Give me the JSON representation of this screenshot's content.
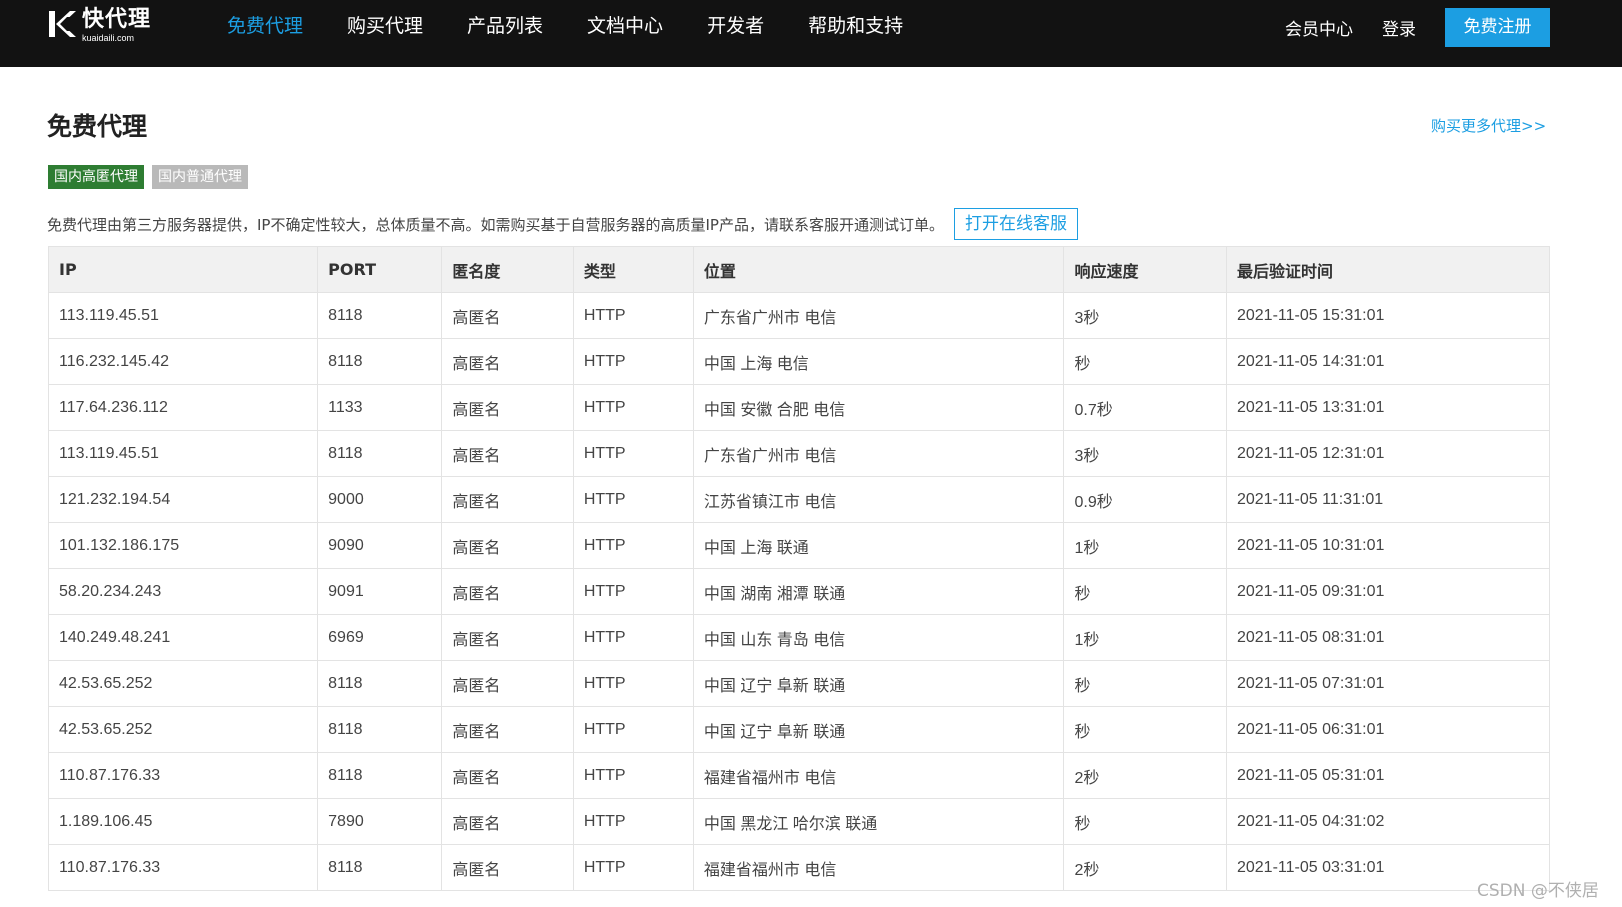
{
  "logo": {
    "cn": "快代理",
    "en": "kuaidaili.com"
  },
  "nav": [
    {
      "label": "免费代理",
      "active": true
    },
    {
      "label": "购买代理",
      "active": false
    },
    {
      "label": "产品列表",
      "active": false
    },
    {
      "label": "文档中心",
      "active": false
    },
    {
      "label": "开发者",
      "active": false
    },
    {
      "label": "帮助和支持",
      "active": false
    }
  ],
  "header_right": {
    "member": "会员中心",
    "login": "登录",
    "register": "免费注册"
  },
  "page": {
    "title": "免费代理",
    "more_link": "购买更多代理>>",
    "tabs": [
      {
        "label": "国内高匿代理",
        "active": true
      },
      {
        "label": "国内普通代理",
        "active": false
      }
    ],
    "notice": "免费代理由第三方服务器提供，IP不确定性较大，总体质量不高。如需购买基于自营服务器的高质量IP产品，请联系客服开通测试订单。",
    "service_button": "打开在线客服"
  },
  "table": {
    "columns": [
      "IP",
      "PORT",
      "匿名度",
      "类型",
      "位置",
      "响应速度",
      "最后验证时间"
    ],
    "rows": [
      [
        "113.119.45.51",
        "8118",
        "高匿名",
        "HTTP",
        "广东省广州市 电信",
        "3秒",
        "2021-11-05 15:31:01"
      ],
      [
        "116.232.145.42",
        "8118",
        "高匿名",
        "HTTP",
        "中国 上海 电信",
        "秒",
        "2021-11-05 14:31:01"
      ],
      [
        "117.64.236.112",
        "1133",
        "高匿名",
        "HTTP",
        "中国 安徽 合肥 电信",
        "0.7秒",
        "2021-11-05 13:31:01"
      ],
      [
        "113.119.45.51",
        "8118",
        "高匿名",
        "HTTP",
        "广东省广州市 电信",
        "3秒",
        "2021-11-05 12:31:01"
      ],
      [
        "121.232.194.54",
        "9000",
        "高匿名",
        "HTTP",
        "江苏省镇江市 电信",
        "0.9秒",
        "2021-11-05 11:31:01"
      ],
      [
        "101.132.186.175",
        "9090",
        "高匿名",
        "HTTP",
        "中国 上海 联通",
        "1秒",
        "2021-11-05 10:31:01"
      ],
      [
        "58.20.234.243",
        "9091",
        "高匿名",
        "HTTP",
        "中国 湖南 湘潭 联通",
        "秒",
        "2021-11-05 09:31:01"
      ],
      [
        "140.249.48.241",
        "6969",
        "高匿名",
        "HTTP",
        "中国 山东 青岛 电信",
        "1秒",
        "2021-11-05 08:31:01"
      ],
      [
        "42.53.65.252",
        "8118",
        "高匿名",
        "HTTP",
        "中国 辽宁 阜新 联通",
        "秒",
        "2021-11-05 07:31:01"
      ],
      [
        "42.53.65.252",
        "8118",
        "高匿名",
        "HTTP",
        "中国 辽宁 阜新 联通",
        "秒",
        "2021-11-05 06:31:01"
      ],
      [
        "110.87.176.33",
        "8118",
        "高匿名",
        "HTTP",
        "福建省福州市 电信",
        "2秒",
        "2021-11-05 05:31:01"
      ],
      [
        "1.189.106.45",
        "7890",
        "高匿名",
        "HTTP",
        "中国 黑龙江 哈尔滨 联通",
        "秒",
        "2021-11-05 04:31:02"
      ],
      [
        "110.87.176.33",
        "8118",
        "高匿名",
        "HTTP",
        "福建省福州市 电信",
        "2秒",
        "2021-11-05 03:31:01"
      ]
    ]
  },
  "watermark": "CSDN @不侠居",
  "colors": {
    "accent": "#1c9ee2",
    "topbar": "#121212",
    "tab_active": "#2e7d32",
    "tab_inactive": "#b9b9b9"
  }
}
